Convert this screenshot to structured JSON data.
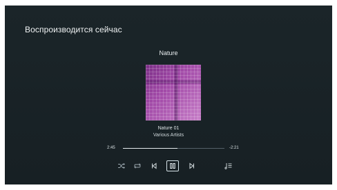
{
  "header": {
    "title": "Воспроизводится сейчас"
  },
  "album": {
    "title": "Nature"
  },
  "track": {
    "title": "Nature 01",
    "artist": "Various Artists"
  },
  "playback": {
    "elapsed": "2:45",
    "remaining": "-2:21",
    "progress_fraction": 0.54
  },
  "controls": {
    "icons": [
      "shuffle-icon",
      "repeat-icon",
      "previous-icon",
      "pause-icon",
      "next-icon",
      "queue-icon"
    ]
  },
  "colors": {
    "background": "#1b2529",
    "text": "#e6ecee",
    "accent_outline": "#d7e4ea",
    "cover_purple": "#a24aa8"
  }
}
